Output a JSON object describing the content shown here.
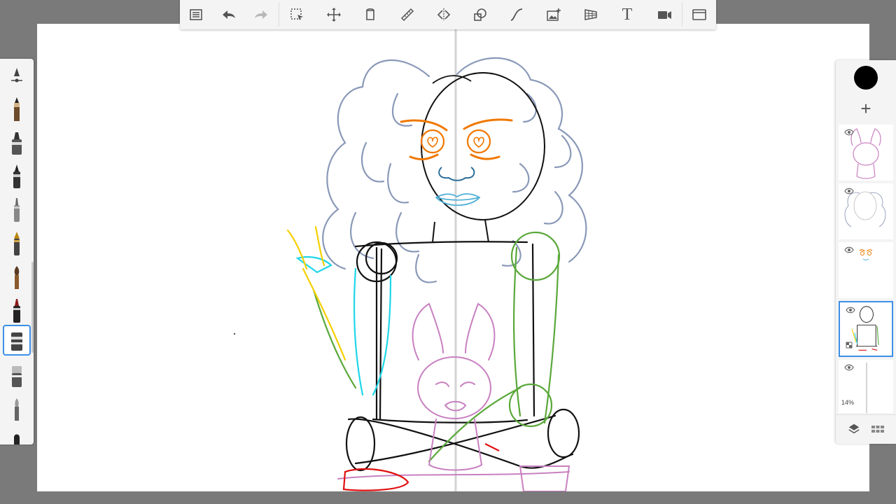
{
  "app": {
    "accent_color": "#3c8fe6",
    "current_color": "#000000"
  },
  "toolbar": {
    "items": [
      {
        "name": "menu-list-icon"
      },
      {
        "name": "undo-icon"
      },
      {
        "name": "redo-icon"
      },
      {
        "name": "selection-icon"
      },
      {
        "name": "transform-icon"
      },
      {
        "name": "fill-icon"
      },
      {
        "name": "ruler-icon"
      },
      {
        "name": "symmetry-icon"
      },
      {
        "name": "shapes-icon"
      },
      {
        "name": "curve-icon"
      },
      {
        "name": "add-image-icon"
      },
      {
        "name": "perspective-icon"
      },
      {
        "name": "text-icon"
      },
      {
        "name": "record-icon"
      },
      {
        "name": "fullscreen-icon"
      }
    ],
    "text_tool_glyph": "T"
  },
  "brushes": {
    "items": [
      "brush-size-slider",
      "pencil",
      "marker",
      "ink-pen",
      "airbrush",
      "fountain-pen",
      "paint-brush",
      "felt-tip",
      "chisel-marker",
      "eraser",
      "smudge-tool",
      "pastel"
    ],
    "selected_index": 8
  },
  "layers": {
    "add_label": "+",
    "items": [
      {
        "name": "layer-pet-sketch",
        "visible": true
      },
      {
        "name": "layer-hair-sketch",
        "visible": true
      },
      {
        "name": "layer-face-sketch",
        "visible": true
      },
      {
        "name": "layer-body-sketch",
        "visible": true,
        "active": true
      },
      {
        "name": "layer-background",
        "visible": true,
        "opacity_label": "14%"
      }
    ]
  }
}
